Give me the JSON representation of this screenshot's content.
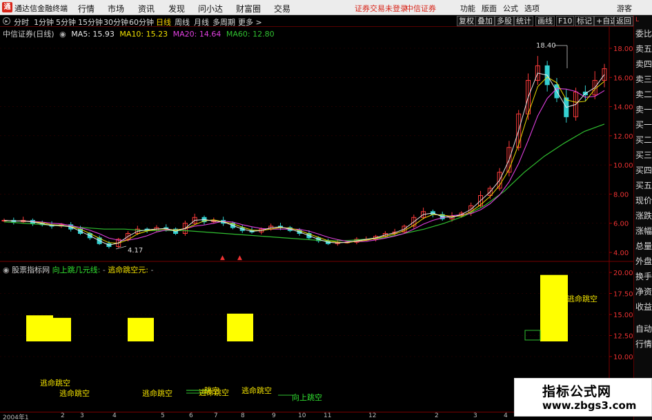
{
  "app": {
    "title": "通达信金融终端",
    "logo": "通",
    "menus": [
      "行情",
      "市场",
      "资讯",
      "发现",
      "问小达",
      "财富圈",
      "交易"
    ],
    "notices": [
      "证券交易未登录",
      "中信证券"
    ],
    "right_menus": [
      "功能",
      "版面",
      "公式",
      "选项"
    ],
    "guest_label": "游客"
  },
  "toolbar": {
    "periods": [
      "分时",
      "1分钟",
      "5分钟",
      "15分钟",
      "30分钟",
      "60分钟",
      "日线",
      "周线",
      "月线",
      "多周期",
      "更多 >"
    ],
    "active_period": "日线",
    "right_buttons": [
      "复权",
      "叠加",
      "多股",
      "统计",
      "画线",
      "F10",
      "标记",
      "+自选",
      "返回"
    ]
  },
  "side_panel": {
    "badge": "L",
    "items": [
      "委比",
      "卖五",
      "卖四",
      "卖三",
      "卖二",
      "卖一",
      "买一",
      "买二",
      "买三",
      "买四",
      "买五",
      "现价",
      "涨跌",
      "涨幅",
      "总量",
      "外盘",
      "换手",
      "净资",
      "收益",
      "自动",
      "行情"
    ]
  },
  "main_chart": {
    "stock_label": "中信证券(日线)",
    "ma_legend": [
      {
        "label": "MA5: 15.93",
        "color": "#e8e8e8"
      },
      {
        "label": "MA10: 15.23",
        "color": "#f0e000"
      },
      {
        "label": "MA20: 14.64",
        "color": "#e040e0"
      },
      {
        "label": "MA60: 12.80",
        "color": "#30c030"
      }
    ],
    "annotations": {
      "high": "18.40",
      "low": "4.17"
    }
  },
  "indicator": {
    "legend_name": "股票指标网",
    "legend_lines": [
      {
        "label": "向上跳几元线:",
        "color": "#30e030"
      },
      {
        "label": "逃命跳空元:",
        "color": "#f0e000"
      }
    ],
    "text_labels": [
      "逃命跳空",
      "逃命跳空",
      "逃命跳空",
      "逃命跳空",
      "逃命跳空",
      "逃命跳空",
      "向上跳空",
      "跳空"
    ]
  },
  "chart_data": [
    {
      "type": "candlestick",
      "name": "中信证券(日线)",
      "ylim": [
        4.0,
        18.4
      ],
      "y_ticks": [
        "18.00",
        "16.00",
        "14.00",
        "12.00",
        "10.00",
        "8.00",
        "6.00",
        "4.00"
      ],
      "approx_close": [
        6.2,
        6.1,
        6.2,
        6.0,
        5.9,
        5.8,
        5.9,
        5.6,
        5.3,
        5.0,
        4.6,
        4.4,
        4.9,
        5.3,
        5.6,
        5.5,
        5.7,
        5.6,
        5.3,
        6.0,
        6.4,
        6.1,
        6.2,
        6.0,
        5.7,
        5.5,
        5.4,
        5.6,
        5.8,
        5.7,
        5.5,
        5.3,
        5.0,
        4.8,
        4.6,
        4.7,
        4.7,
        4.9,
        4.9,
        5.1,
        5.3,
        5.4,
        5.8,
        6.4,
        6.8,
        6.6,
        6.3,
        6.5,
        6.7,
        7.2,
        7.9,
        8.4,
        9.5,
        11.2,
        13.5,
        15.8,
        16.8,
        15.5,
        14.6,
        13.3,
        15.0,
        14.8,
        15.8,
        16.6
      ],
      "ma60_approx": [
        6.1,
        6.0,
        5.9,
        5.8,
        5.7,
        5.6,
        5.6,
        5.5,
        5.5,
        5.5,
        5.4,
        5.3,
        5.2,
        5.1,
        5.0,
        4.9,
        4.8,
        4.8,
        4.9,
        5.0,
        5.3,
        5.6,
        6.0,
        6.5,
        7.2,
        8.2,
        9.5,
        10.6,
        11.5,
        12.3,
        12.8
      ],
      "high_label": "18.40",
      "low_label": "4.17"
    },
    {
      "type": "bar",
      "name": "indicator",
      "ylim": [
        7.5,
        20.0
      ],
      "y_ticks": [
        "20.00",
        "17.50",
        "15.00",
        "12.50",
        "10.00"
      ],
      "bars": [
        {
          "bottom": 11.8,
          "top": 14.9
        },
        {
          "bottom": 11.8,
          "top": 14.6
        },
        {
          "bottom": 11.8,
          "top": 14.6
        },
        {
          "bottom": 11.8,
          "top": 15.1
        },
        {
          "bottom": 11.8,
          "top": 19.7
        }
      ]
    }
  ],
  "date_axis": {
    "labels": [
      "2004年1",
      "2",
      "3",
      "4",
      "5",
      "6",
      "7",
      "8",
      "9",
      "10",
      "11",
      "12",
      "2",
      "3",
      "4"
    ]
  },
  "watermark": {
    "line1": "指标公式网",
    "line2": "www.zbgs3.com"
  }
}
